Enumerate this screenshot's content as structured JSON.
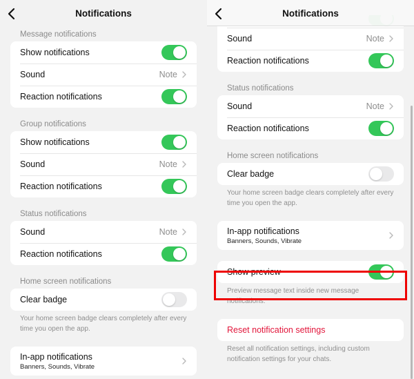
{
  "left": {
    "header": {
      "title": "Notifications",
      "back_icon": "chevron-left-icon"
    },
    "sections": [
      {
        "label": "Message notifications",
        "rows": [
          {
            "label": "Show notifications",
            "type": "toggle",
            "on": true
          },
          {
            "label": "Sound",
            "type": "value",
            "value": "Note"
          },
          {
            "label": "Reaction notifications",
            "type": "toggle",
            "on": true
          }
        ]
      },
      {
        "label": "Group notifications",
        "rows": [
          {
            "label": "Show notifications",
            "type": "toggle",
            "on": true
          },
          {
            "label": "Sound",
            "type": "value",
            "value": "Note"
          },
          {
            "label": "Reaction notifications",
            "type": "toggle",
            "on": true
          }
        ]
      },
      {
        "label": "Status notifications",
        "rows": [
          {
            "label": "Sound",
            "type": "value",
            "value": "Note"
          },
          {
            "label": "Reaction notifications",
            "type": "toggle",
            "on": true
          }
        ]
      },
      {
        "label": "Home screen notifications",
        "rows": [
          {
            "label": "Clear badge",
            "type": "toggle",
            "on": false
          }
        ],
        "footnote": "Your home screen badge clears completely after every time you open the app."
      },
      {
        "rows": [
          {
            "label": "In-app notifications",
            "sub": "Banners, Sounds, Vibrate",
            "type": "nav"
          }
        ]
      }
    ]
  },
  "right": {
    "header": {
      "title": "Notifications",
      "back_icon": "chevron-left-icon"
    },
    "sections": [
      {
        "rows": [
          {
            "label": "Sound",
            "type": "value",
            "value": "Note"
          },
          {
            "label": "Reaction notifications",
            "type": "toggle",
            "on": true
          }
        ]
      },
      {
        "label": "Status notifications",
        "rows": [
          {
            "label": "Sound",
            "type": "value",
            "value": "Note"
          },
          {
            "label": "Reaction notifications",
            "type": "toggle",
            "on": true
          }
        ]
      },
      {
        "label": "Home screen notifications",
        "rows": [
          {
            "label": "Clear badge",
            "type": "toggle",
            "on": false
          }
        ],
        "footnote": "Your home screen badge clears completely after every time you open the app."
      },
      {
        "rows": [
          {
            "label": "In-app notifications",
            "sub": "Banners, Sounds, Vibrate",
            "type": "nav"
          }
        ]
      },
      {
        "rows": [
          {
            "label": "Show preview",
            "type": "toggle",
            "on": true,
            "highlighted": true
          }
        ],
        "footnote": "Preview message text inside new message notifications."
      },
      {
        "rows": [
          {
            "label": "Reset notification settings",
            "type": "action",
            "danger": true
          }
        ],
        "footnote": "Reset all notification settings, including custom notification settings for your chats."
      }
    ]
  },
  "colors": {
    "toggle_on": "#34c759",
    "toggle_off": "#e9e9ea",
    "danger": "#e2163b",
    "highlight": "#ee0000",
    "background": "#f2f2f2"
  }
}
